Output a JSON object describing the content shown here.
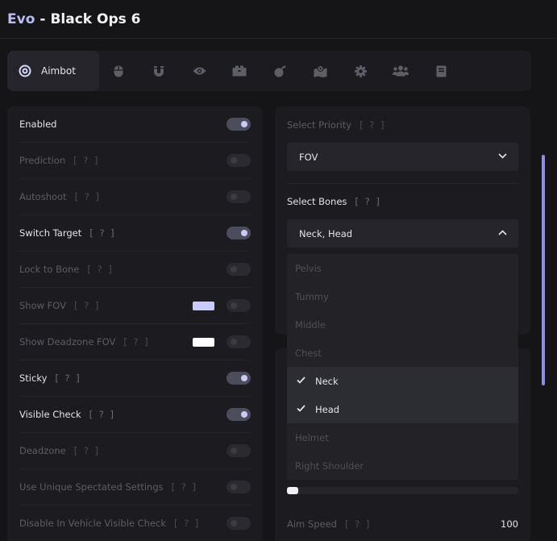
{
  "header": {
    "brand": "Evo",
    "separator": "-",
    "title": "Black Ops 6"
  },
  "tabs": [
    {
      "label": "Aimbot",
      "icon": "target-icon",
      "active": true
    },
    {
      "label": "",
      "icon": "mouse-icon"
    },
    {
      "label": "",
      "icon": "magnet-icon"
    },
    {
      "label": "",
      "icon": "eye-icon"
    },
    {
      "label": "",
      "icon": "boxes-icon"
    },
    {
      "label": "",
      "icon": "bomb-icon"
    },
    {
      "label": "",
      "icon": "map-icon"
    },
    {
      "label": "",
      "icon": "gear-icon"
    },
    {
      "label": "",
      "icon": "users-icon"
    },
    {
      "label": "",
      "icon": "book-icon"
    }
  ],
  "aimbot": {
    "rows": [
      {
        "label": "Enabled",
        "help": "",
        "enabled": true,
        "toggle": true
      },
      {
        "label": "Prediction",
        "help": "[ ? ]",
        "enabled": false,
        "toggle": false
      },
      {
        "label": "Autoshoot",
        "help": "[ ? ]",
        "enabled": false,
        "toggle": false
      },
      {
        "label": "Switch Target",
        "help": "[ ? ]",
        "enabled": true,
        "toggle": true
      },
      {
        "label": "Lock to Bone",
        "help": "[ ? ]",
        "enabled": false,
        "toggle": false
      },
      {
        "label": "Show FOV",
        "help": "[ ? ]",
        "enabled": false,
        "toggle": false,
        "swatch": "#c9cbfa"
      },
      {
        "label": "Show Deadzone FOV",
        "help": "[ ? ]",
        "enabled": false,
        "toggle": false,
        "swatch": "#ffffff"
      },
      {
        "label": "Sticky",
        "help": "[ ? ]",
        "enabled": true,
        "toggle": true
      },
      {
        "label": "Visible Check",
        "help": "[ ? ]",
        "enabled": true,
        "toggle": true
      },
      {
        "label": "Deadzone",
        "help": "[ ? ]",
        "enabled": false,
        "toggle": false
      },
      {
        "label": "Use Unique Spectated Settings",
        "help": "[ ? ]",
        "enabled": false,
        "toggle": false
      },
      {
        "label": "Disable In Vehicle Visible Check",
        "help": "[ ? ]",
        "enabled": false,
        "toggle": false
      }
    ]
  },
  "priority": {
    "label": "Select Priority",
    "help": "[ ? ]",
    "value": "FOV"
  },
  "bones": {
    "label": "Select Bones",
    "help": "[ ? ]",
    "value": "Neck, Head",
    "options": [
      {
        "label": "Pelvis",
        "selected": false
      },
      {
        "label": "Tummy",
        "selected": false
      },
      {
        "label": "Middle",
        "selected": false
      },
      {
        "label": "Chest",
        "selected": false
      },
      {
        "label": "Neck",
        "selected": true
      },
      {
        "label": "Head",
        "selected": true
      },
      {
        "label": "Helmet",
        "selected": false
      },
      {
        "label": "Right Shoulder",
        "selected": false
      }
    ]
  },
  "aim_speed": {
    "label": "Aim Speed",
    "help": "[ ? ]",
    "value": "100"
  },
  "colors": {
    "accent": "#c9cbf6",
    "brand": "#b9bcf5",
    "scrollbar": "#8d90e0"
  }
}
